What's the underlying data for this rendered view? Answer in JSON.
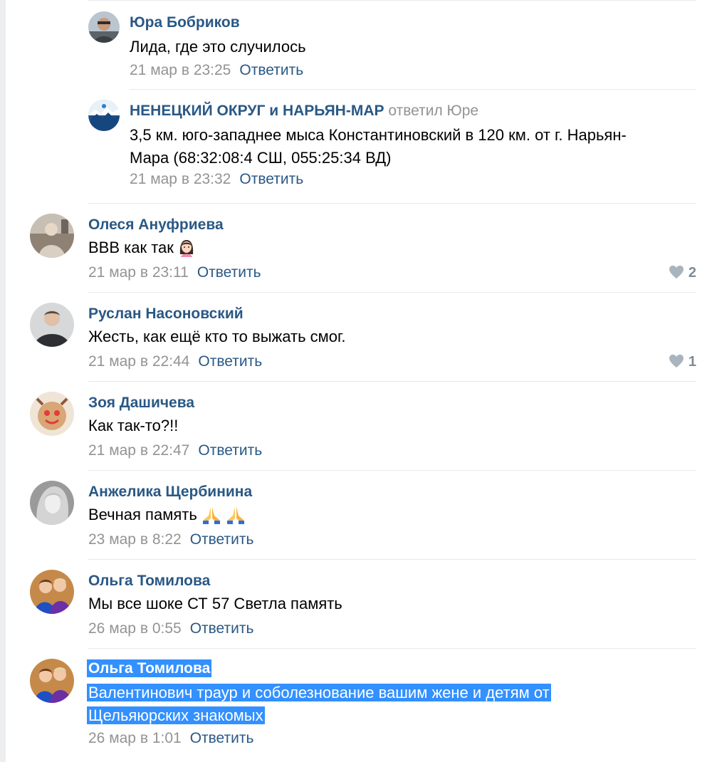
{
  "reply_label": "Ответить",
  "comments": [
    {
      "author": "Юра Бобриков",
      "text": "Лида, где это случилось",
      "date": "21 мар в 23:25"
    },
    {
      "author": "НЕНЕЦКИЙ ОКРУГ и НАРЬЯН-МАР",
      "replied_to": "ответил Юре",
      "text_line1": "3,5 км. юго-западнее мыса Константиновский в 120 км. от г. Нарьян-",
      "text_line2": "Мара (68:32:08:4 СШ, 055:25:34 ВД)",
      "date": "21 мар в 23:32"
    },
    {
      "author": "Олеся Ануфриева",
      "text": "ВВВ как так",
      "date": "21 мар в 23:11",
      "likes": "2"
    },
    {
      "author": "Руслан Насоновский",
      "text": "Жесть, как ещё кто то выжать смог.",
      "date": "21 мар в 22:44",
      "likes": "1"
    },
    {
      "author": "Зоя Дашичева",
      "text": "Как так-то?!!",
      "date": "21 мар в 22:47"
    },
    {
      "author": "Анжелика Щербинина",
      "text": "Вечная память",
      "date": "23 мар в 8:22"
    },
    {
      "author": "Ольга Томилова",
      "text": "Мы все шоке СТ 57 Светла память",
      "date": "26 мар в 0:55"
    },
    {
      "author": "Ольга Томилова",
      "text_line1": "Валентинович траур и соболезнование вашим жене и детям от",
      "text_line2": "Щельяюрских знакомых",
      "date": "26 мар в 1:01"
    }
  ],
  "colors": {
    "link": "#2a5885",
    "meta": "#939393",
    "selection": "#3390ff",
    "divider": "#e7e8ec"
  },
  "icons": {
    "like": "heart-icon",
    "emoji_woman": "woman-emoji-icon",
    "emoji_pray": "folded-hands-emoji-icon"
  }
}
